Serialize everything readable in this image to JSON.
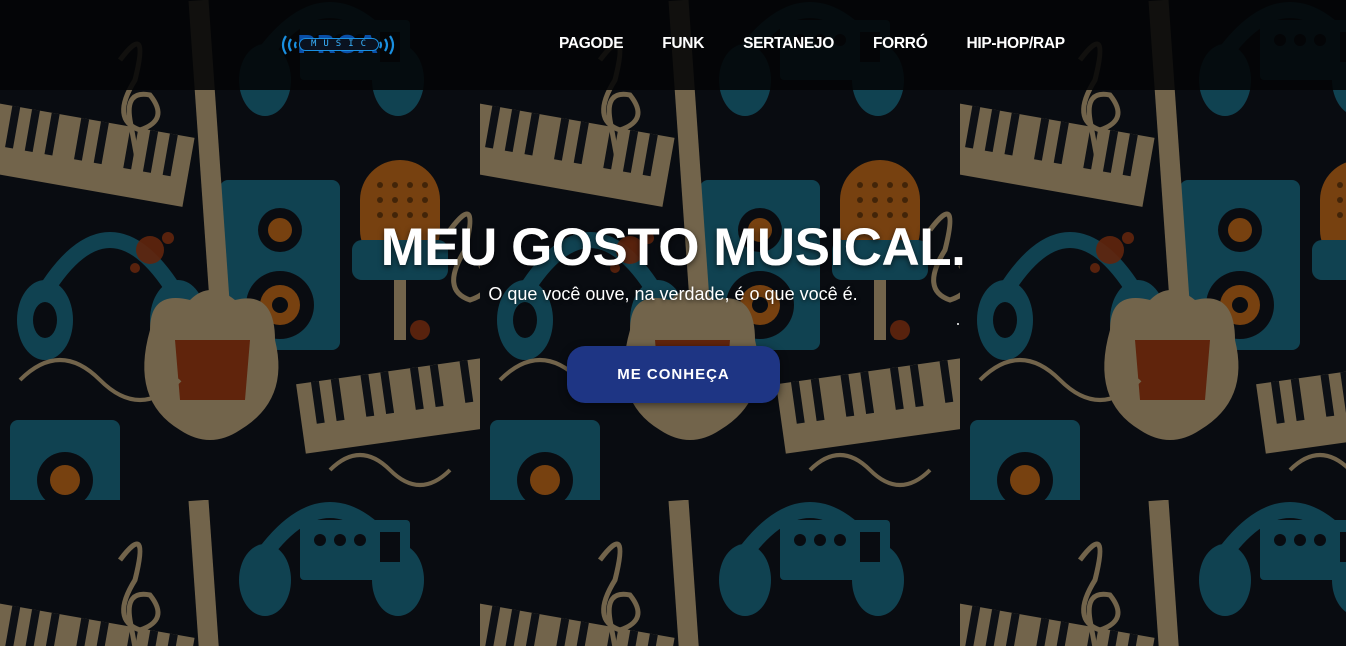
{
  "theme": {
    "nav_background": "#030406",
    "accent": "#1e3584",
    "logo_blue": "#0a4fa8",
    "logo_cyan": "#1a8fe0",
    "text": "#ffffff",
    "background_pattern_colors": [
      "#1b6b84",
      "#c06a1a",
      "#b8a27a",
      "#9c3a14",
      "#0f141c"
    ]
  },
  "brand": {
    "logo_word": "PROA",
    "logo_sub": "MUSIC",
    "logo_icons": [
      "sound-wave-left-icon",
      "sound-wave-right-icon"
    ]
  },
  "nav": {
    "items": [
      {
        "label": "PAGODE"
      },
      {
        "label": "FUNK"
      },
      {
        "label": "SERTANEJO"
      },
      {
        "label": "FORRÓ"
      },
      {
        "label": "HIP-HOP/RAP"
      }
    ]
  },
  "hero": {
    "title": "MEU GOSTO MUSICAL.",
    "subtitle": "O que você ouve, na verdade, é o que você é.",
    "cta_label": "ME CONHEÇA",
    "background_icons": [
      "headphones-icon",
      "microphone-icon",
      "guitar-icon",
      "speaker-icon",
      "keyboard-icon",
      "treble-clef-icon",
      "audio-cable-icon"
    ]
  }
}
